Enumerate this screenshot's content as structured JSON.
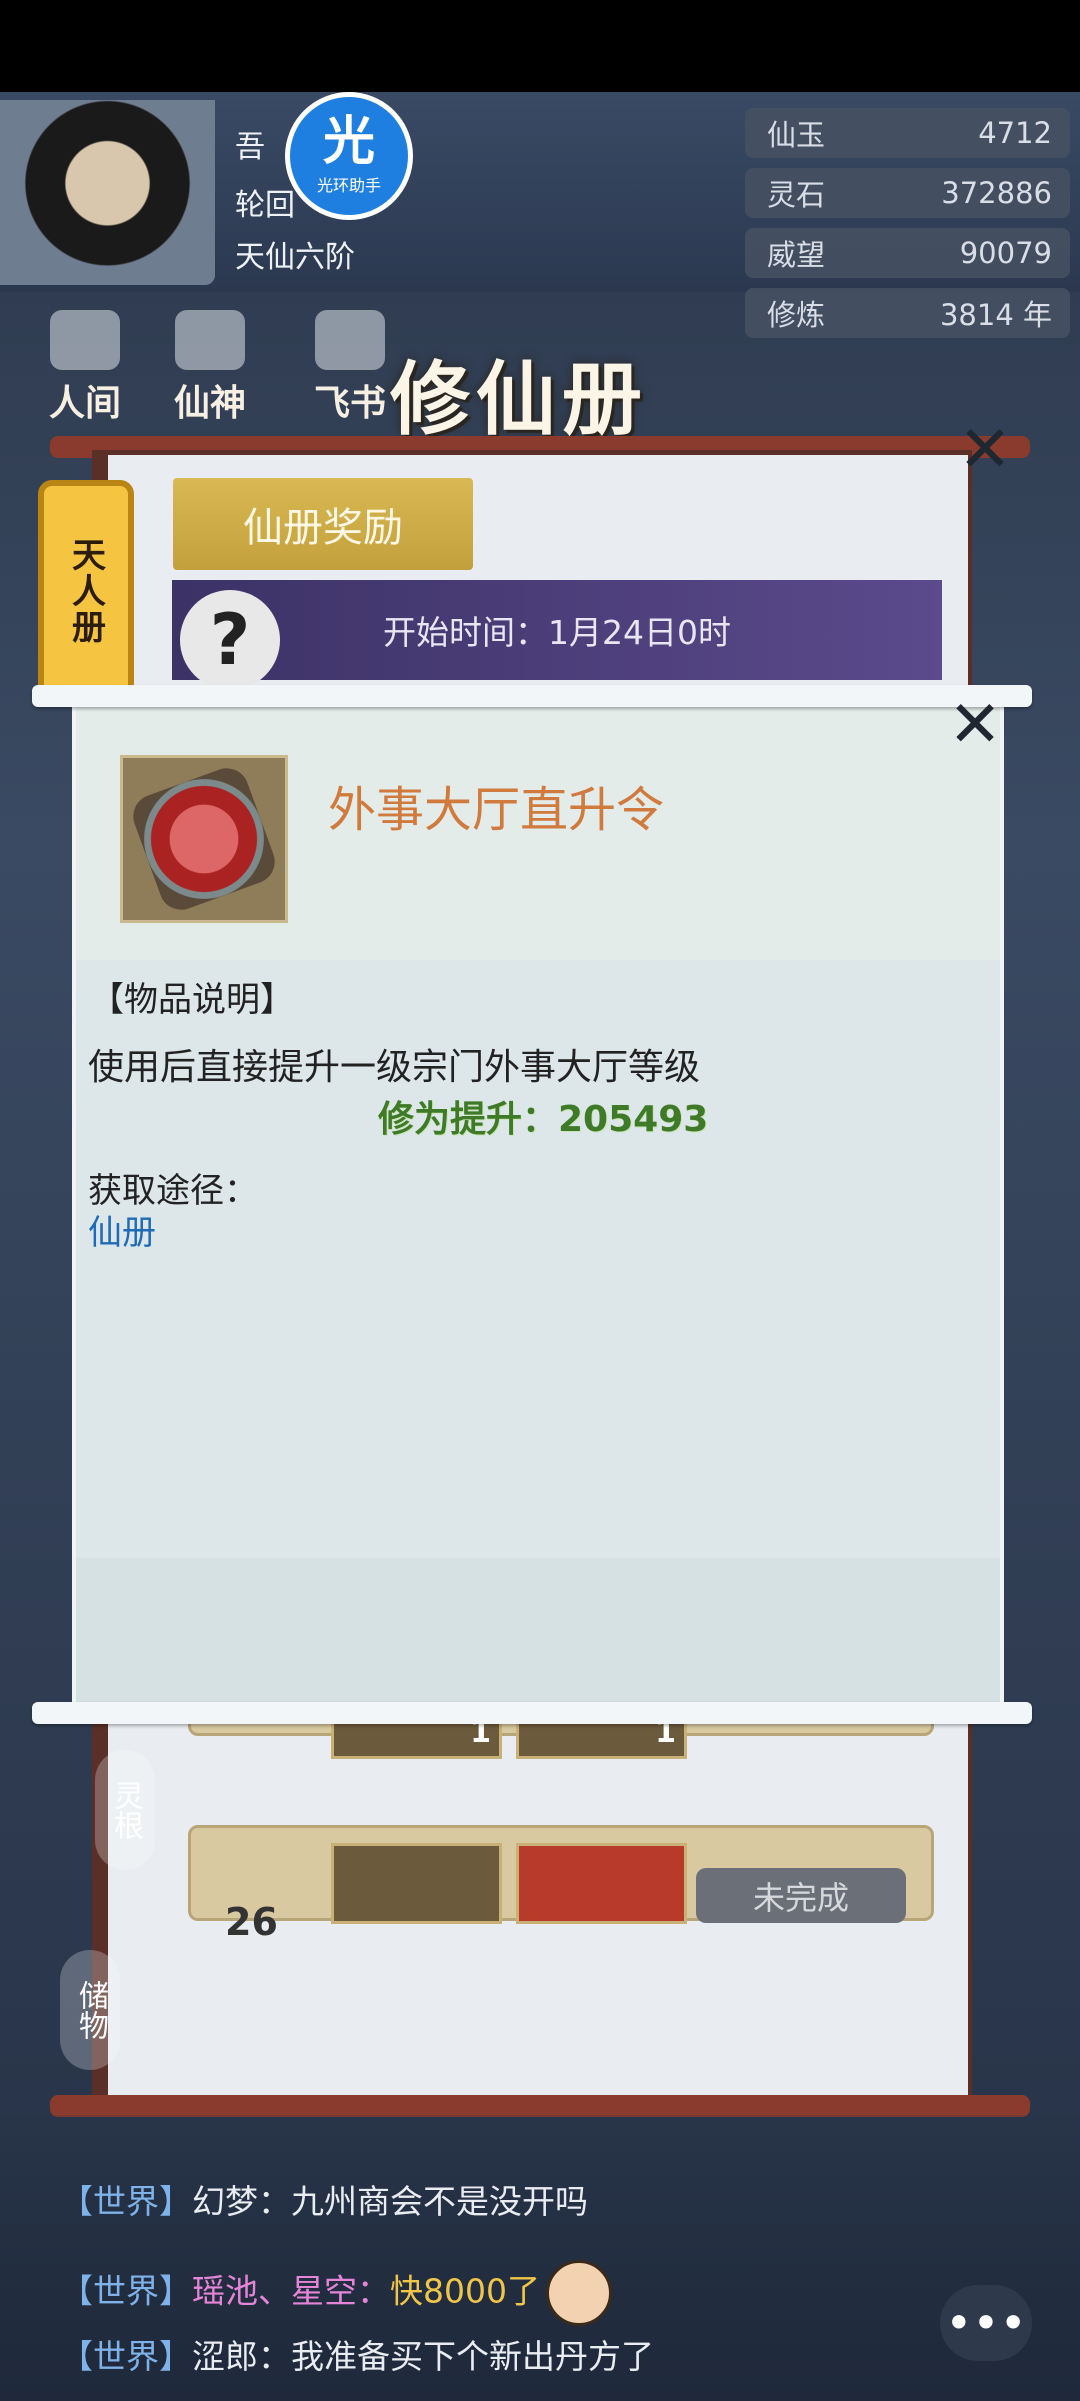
{
  "player": {
    "name_partial": "吾",
    "realm_partial": "轮回",
    "rank": "天仙六阶"
  },
  "helper_badge": {
    "glyph": "光",
    "label": "光环助手"
  },
  "resources": [
    {
      "label": "仙玉",
      "value": "4712"
    },
    {
      "label": "灵石",
      "value": "372886"
    },
    {
      "label": "威望",
      "value": "90079"
    },
    {
      "label": "修炼",
      "value": "3814 年"
    }
  ],
  "nav": {
    "items": [
      {
        "label": "人间"
      },
      {
        "label": "仙神"
      },
      {
        "label": "飞书"
      }
    ],
    "book_title": "修仙册"
  },
  "book": {
    "side_tab": "天人册",
    "reward_button": "仙册奖励",
    "start_time": "开始时间：1月24日0时",
    "task_quantities": [
      "1",
      "1"
    ],
    "task_button": "未完成",
    "level_number": "26"
  },
  "side_chips": [
    "灵根",
    "储物"
  ],
  "modal": {
    "item_name": "外事大厅直升令",
    "desc_heading": "【物品说明】",
    "desc_text": "使用后直接提升一级宗门外事大厅等级",
    "cultivation_boost": "修为提升：205493",
    "obtain_label": "获取途径：",
    "obtain_source": "仙册",
    "close_icon": "✕"
  },
  "chat": {
    "lines": [
      {
        "channel": "【世界】",
        "name": "幻梦：",
        "message": "九州商会不是没开吗"
      },
      {
        "channel": "【世界】",
        "name": "瑶池、星空：",
        "message": "快8000了"
      },
      {
        "channel": "【世界】",
        "name": "涩郎：",
        "message": "我准备买下个新出丹方了"
      }
    ],
    "button_glyph": "•••"
  },
  "colors": {
    "item_name": "#d07a3e",
    "cultivation": "#3f7a28",
    "link": "#1f6bb8",
    "tab_gold": "#f5c542"
  }
}
